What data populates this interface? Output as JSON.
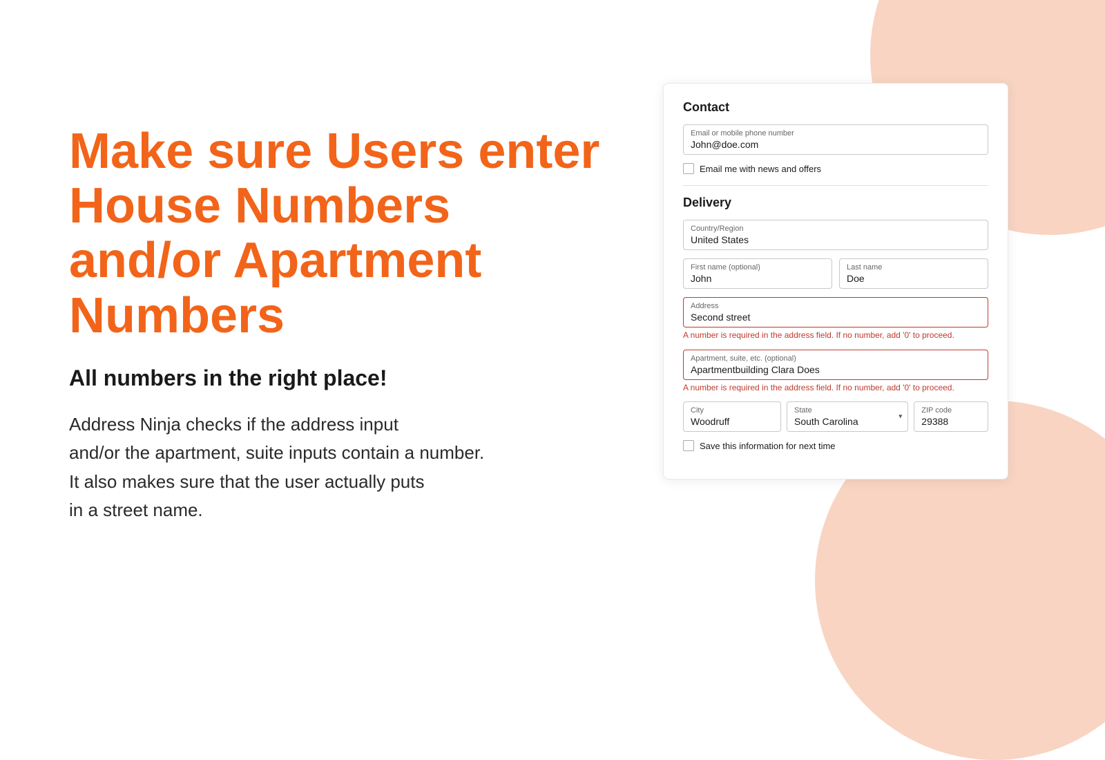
{
  "decorative": {
    "circle_color": "#f9d4c2"
  },
  "left": {
    "hero_title": "Make sure Users enter House Numbers and/or Apartment Numbers",
    "subtitle": "All numbers in the right place!",
    "description_line1": "Address Ninja checks if the address input",
    "description_line2": "and/or the apartment, suite inputs contain a number.",
    "description_line3": "It also makes sure that the user actually puts",
    "description_line4": "in a street name."
  },
  "form": {
    "contact_section": "Contact",
    "email_label": "Email or mobile phone number",
    "email_value": "John@doe.com",
    "email_checkbox_label": "Email me with news and offers",
    "delivery_section": "Delivery",
    "country_label": "Country/Region",
    "country_value": "United States",
    "first_name_label": "First name (optional)",
    "first_name_value": "John",
    "last_name_label": "Last name",
    "last_name_value": "Doe",
    "address_label": "Address",
    "address_value": "Second street",
    "address_error": "A number is required in the address field. If no number, add '0' to proceed.",
    "apartment_label": "Apartment, suite, etc. (optional)",
    "apartment_value": "Apartmentbuilding Clara Does",
    "apartment_error": "A number is required in the address field. If no number, add '0' to proceed.",
    "city_label": "City",
    "city_value": "Woodruff",
    "state_label": "State",
    "state_value": "South Carolina",
    "zip_label": "ZIP code",
    "zip_value": "29388",
    "save_checkbox_label": "Save this information for next time"
  }
}
